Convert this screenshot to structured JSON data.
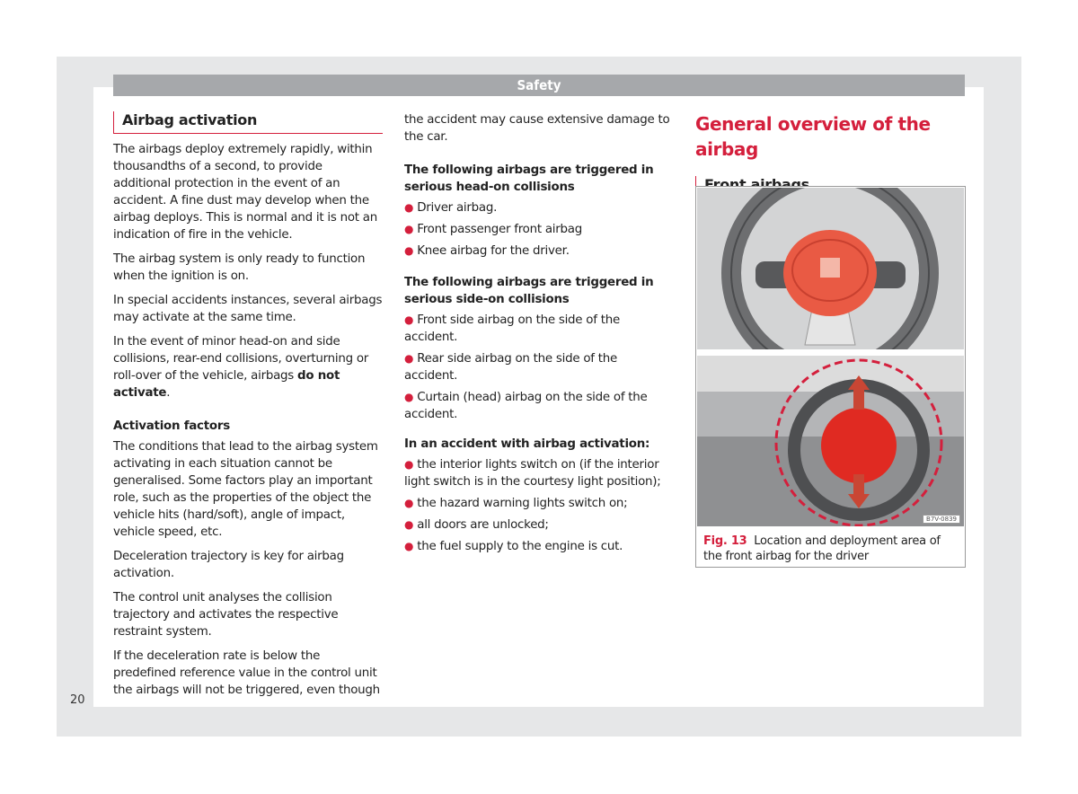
{
  "header": {
    "section": "Safety"
  },
  "page_number": "20",
  "left": {
    "heading": "Airbag activation",
    "paragraphs": [
      "The airbags deploy extremely rapidly, within thousandths of a second, to provide additional protection in the event of an accident. A fine dust may develop when the airbag deploys. This is normal and it is not an indication of fire in the vehicle.",
      "The airbag system is only ready to function when the ignition is on.",
      "In special accidents instances, several airbags may activate at the same time."
    ],
    "minor_collision_text": "In the event of minor head-on and side collisions, rear-end collisions, overturning or roll-over of the vehicle, airbags ",
    "minor_collision_bold": "do not activate",
    "minor_collision_end": ".",
    "subheading": "Activation factors",
    "factor_paragraphs": [
      "The conditions that lead to the airbag system activating in each situation cannot be generalised. Some factors play an important role, such as the properties of the object the vehicle hits (hard/soft), angle of impact, vehicle speed, etc.",
      "Deceleration trajectory is key for airbag activation.",
      "The control unit analyses the collision trajectory and activates the respective restraint system.",
      "If the deceleration rate is below the predefined reference value in the control unit the airbags will not be triggered, even though"
    ]
  },
  "middle": {
    "continuation": "the accident may cause extensive damage to the car.",
    "head_on_heading": "The following airbags are triggered in serious head-on collisions",
    "head_on_items": [
      "Driver airbag.",
      "Front passenger front airbag",
      "Knee airbag for the driver."
    ],
    "side_heading": "The following airbags are triggered in serious side-on collisions",
    "side_items": [
      "Front side airbag on the side of the accident.",
      "Rear side airbag on the side of the accident.",
      "Curtain (head) airbag on the side of the accident."
    ],
    "activation_heading": "In an accident with airbag activation:",
    "activation_items": [
      "the interior lights switch on (if the interior light switch is in the courtesy light position);",
      "the hazard warning lights switch on;",
      "all doors are unlocked;",
      "the fuel supply to the engine is cut."
    ]
  },
  "right": {
    "title": "General overview of the airbag",
    "subheading": "Front airbags",
    "figure": {
      "label": "Fig. 13",
      "caption": "Location and deployment area of the front airbag for the driver",
      "code": "B7V-0839"
    }
  },
  "colors": {
    "accent": "#d41f3c",
    "header_band": "#a6a8ab",
    "frame": "#e6e7e8"
  }
}
